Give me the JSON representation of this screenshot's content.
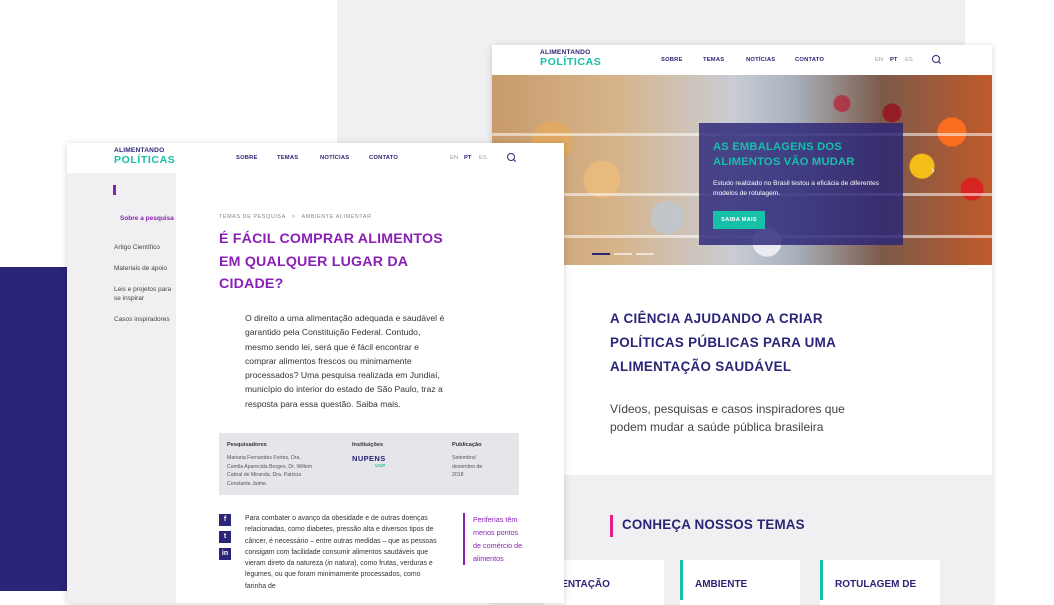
{
  "colors": {
    "navy": "#2a2576",
    "teal": "#16c0a9",
    "purple": "#8a1fb5",
    "magenta": "#e11f8e",
    "light_gray": "#f0f0f2"
  },
  "logo": {
    "line1": "ALIMENTANDO",
    "line2": "POLÍTICAS"
  },
  "nav": [
    "SOBRE",
    "TEMAS",
    "NOTÍCIAS",
    "CONTATO"
  ],
  "langs": [
    "EN",
    "PT",
    "ES"
  ],
  "active_lang": "PT",
  "home": {
    "hero": {
      "title": "AS EMBALAGENS DOS ALIMENTOS VÃO MUDAR",
      "description": "Estudo realizado no Brasil testou a eficácia de diferentes modelos de rotulagem.",
      "button": "SAIBA MAIS",
      "next_icon": "chevron-right-icon",
      "slide_count": 3,
      "active_slide": 1
    },
    "heading": "A CIÊNCIA AJUDANDO A CRIAR POLÍTICAS PÚBLICAS PARA UMA ALIMENTAÇÃO SAUDÁVEL",
    "subheading": "Vídeos, pesquisas e casos inspiradores que podem mudar a saúde pública brasileira",
    "temas_title": "CONHEÇA NOSSOS TEMAS",
    "temas": [
      "LIMENTAÇÃO",
      "AMBIENTE",
      "ROTULAGEM DE"
    ]
  },
  "article": {
    "sidebar": [
      "Sobre a pesquisa",
      "Artigo Científico",
      "Materiais de apoio",
      "Leis e projetos para se inspirar",
      "Casos inspiradores"
    ],
    "breadcrumb": {
      "section": "TEMAS DE PESQUISA",
      "separator": ">",
      "current": "AMBIENTE ALIMENTAR"
    },
    "title": "É FÁCIL COMPRAR ALIMENTOS EM QUALQUER LUGAR DA CIDADE?",
    "intro": "O direito a uma alimentação adequada e saudável é garantido pela Constituição Federal. Contudo, mesmo sendo lei, será que é fácil encontrar e comprar alimentos frescos ou minimamente processados? Uma pesquisa realizada em Jundiaí, município do interior do estado de São Paulo, traz a resposta para essa questão. Saiba mais.",
    "info": {
      "researchers_label": "Pesquisadores",
      "researchers": "Mariana Fernandes Fortes, Dra. Camila Aparecida Borges, Dr. Willem Cabral de Miranda, Dra. Patricia Constante Jaime.",
      "institutions_label": "Instituições",
      "institution_logo": "NUPENS",
      "institution_logo_sub": "USP",
      "publication_label": "Publicação",
      "publication": "Setembro/ dezembro de 2018"
    },
    "share": [
      "f",
      "t",
      "in"
    ],
    "body_before": "Para combater o avanço da obesidade e de outras doenças relacionadas, como diabetes, pressão alta e diversos tipos de câncer, é necessário – entre outras medidas – que as pessoas consigam com facilidade consumir alimentos saudáveis que vieram direto da natureza (",
    "body_em": "in natura",
    "body_after": "), como frutas, verduras e legumes, ou que foram minimamente processados, como farinha de",
    "quote": "Periferias têm menos pontos de comércio de alimentos"
  }
}
